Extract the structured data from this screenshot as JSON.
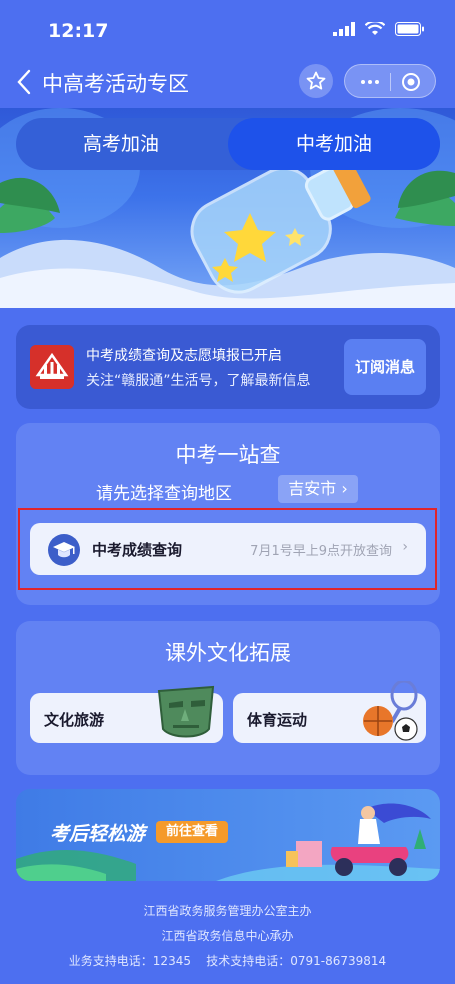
{
  "status_bar": {
    "time": "12:17"
  },
  "nav": {
    "title": "中高考活动专区"
  },
  "tabs": [
    {
      "label": "高考加油",
      "active": false
    },
    {
      "label": "中考加油",
      "active": true
    }
  ],
  "notice": {
    "line1": "中考成绩查询及志愿填报已开启",
    "line2": "关注“赣服通”生活号，了解最新信息",
    "button": "订阅消息"
  },
  "query_section": {
    "title": "中考一站查",
    "region_prompt": "请先选择查询地区",
    "region_value": "吉安市 ›",
    "result_label": "中考成绩查询",
    "result_hint": "7月1号早上9点开放查询",
    "result_chevron": "›"
  },
  "extra_section": {
    "title": "课外文化拓展",
    "tiles": [
      {
        "label": "文化旅游",
        "icon": "bronze-mask-icon"
      },
      {
        "label": "体育运动",
        "icon": "sports-balls-icon"
      }
    ]
  },
  "travel_banner": {
    "title": "考后轻松游",
    "button": "前往查看"
  },
  "footer": {
    "line1": "江西省政务服务管理办公室主办",
    "line2": "江西省政务信息中心承办",
    "line3": "业务支持电话：12345    技术支持电话：0791-86739814"
  },
  "colors": {
    "page_bg": "#4d6ff0",
    "active_tab": "#1e52ea",
    "highlight_border": "#e0252b",
    "travel_button": "#f59a2a"
  }
}
